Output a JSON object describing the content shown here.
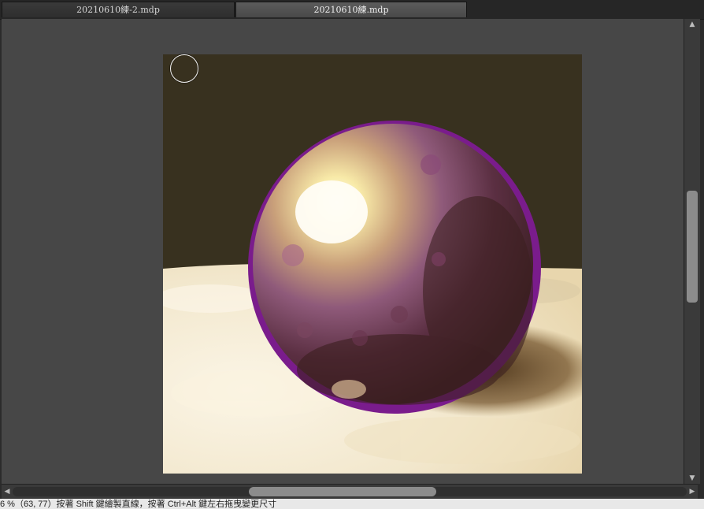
{
  "tabs": [
    {
      "label": "20210610練-2.mdp",
      "active": false
    },
    {
      "label": "20210610練.mdp",
      "active": true
    }
  ],
  "canvas": {
    "subject": "painted purple sphere on cream surface",
    "colors": {
      "background": "#38311f",
      "floor": "#f0e6cc",
      "sphere": "#6b2d6e",
      "rim": "#8a1fa0",
      "highlight": "#fffbe8"
    }
  },
  "scrollbars": {
    "vertical": {
      "up_icon": "triangle-up",
      "down_icon": "triangle-down"
    },
    "horizontal": {
      "left_icon": "triangle-left",
      "right_icon": "triangle-right"
    }
  },
  "status": {
    "text": "6 %（63, 77）按著 Shift 鍵繪製直線，按著 Ctrl+Alt 鍵左右拖曳變更尺寸"
  }
}
